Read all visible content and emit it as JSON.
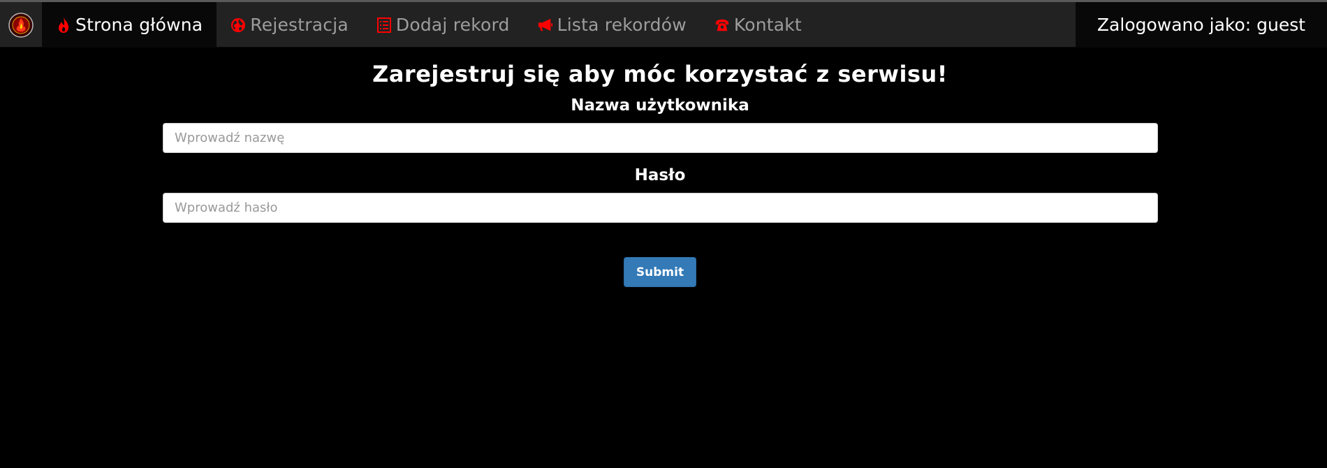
{
  "colors": {
    "navbar_bg": "#222222",
    "active_bg": "#080808",
    "nav_text": "#9d9d9d",
    "icon_red": "#ff0000",
    "page_bg": "#000000",
    "button_bg": "#337ab7"
  },
  "navbar": {
    "logo_icon": "emblem-logo-icon",
    "items": [
      {
        "label": "Strona główna",
        "icon": "fire-icon",
        "active": true
      },
      {
        "label": "Rejestracja",
        "icon": "globe-icon",
        "active": false
      },
      {
        "label": "Dodaj rekord",
        "icon": "list-icon",
        "active": false
      },
      {
        "label": "Lista rekordów",
        "icon": "bullhorn-icon",
        "active": false
      },
      {
        "label": "Kontakt",
        "icon": "phone-icon",
        "active": false
      }
    ],
    "user_status": "Zalogowano jako: guest"
  },
  "form": {
    "title": "Zarejestruj się aby móc korzystać z serwisu!",
    "username_label": "Nazwa użytkownika",
    "username_placeholder": "Wprowadź nazwę",
    "username_value": "",
    "password_label": "Hasło",
    "password_placeholder": "Wprowadź hasło",
    "password_value": "",
    "submit_label": "Submit"
  }
}
